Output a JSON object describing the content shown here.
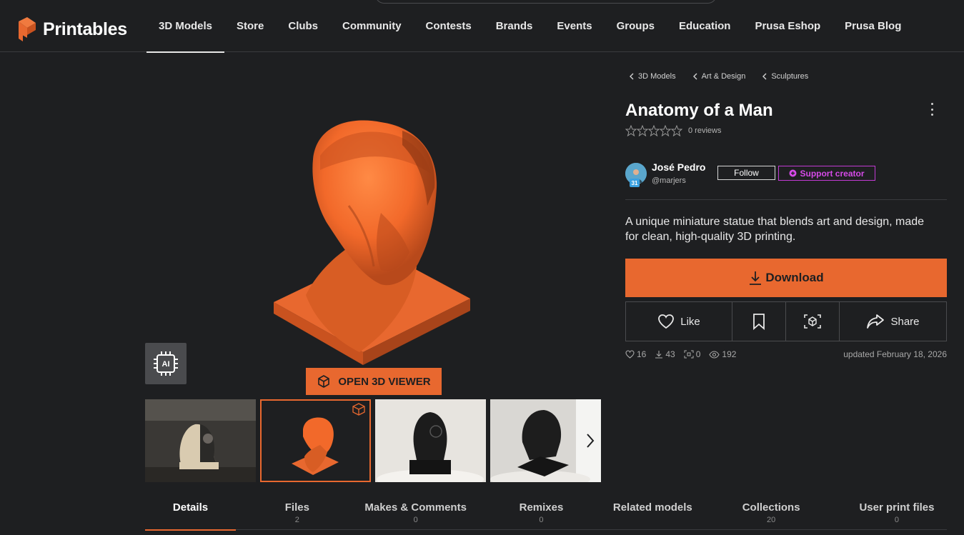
{
  "brand": {
    "name": "Printables",
    "accent": "#e8682f",
    "support_color": "#d54ae8"
  },
  "nav": [
    {
      "label": "3D Models",
      "active": true
    },
    {
      "label": "Store"
    },
    {
      "label": "Clubs"
    },
    {
      "label": "Community"
    },
    {
      "label": "Contests"
    },
    {
      "label": "Brands"
    },
    {
      "label": "Events"
    },
    {
      "label": "Groups"
    },
    {
      "label": "Education"
    },
    {
      "label": "Prusa Eshop"
    },
    {
      "label": "Prusa Blog"
    }
  ],
  "breadcrumbs": [
    "3D Models",
    "Art & Design",
    "Sculptures"
  ],
  "model": {
    "title": "Anatomy of a Man",
    "rating_stars": 0,
    "reviews": "0 reviews",
    "description": "A unique miniature statue that blends art and design, made for clean, high-quality 3D printing."
  },
  "author": {
    "name": "José Pedro",
    "handle": "@marjers",
    "level": "31",
    "follow_label": "Follow",
    "support_label": "Support creator"
  },
  "gallery": {
    "ai_label": "AI",
    "viewer_label": "OPEN 3D VIEWER",
    "thumbnail_count": 4,
    "selected_thumbnail": 2
  },
  "actions": {
    "download": "Download",
    "like": "Like",
    "share": "Share"
  },
  "stats": {
    "likes": "16",
    "downloads": "43",
    "makes": "0",
    "views": "192",
    "updated": "updated February 18, 2026"
  },
  "tabs": [
    {
      "label": "Details",
      "count": "",
      "active": true
    },
    {
      "label": "Files",
      "count": "2"
    },
    {
      "label": "Makes & Comments",
      "count": "0"
    },
    {
      "label": "Remixes",
      "count": "0"
    },
    {
      "label": "Related models",
      "count": ""
    },
    {
      "label": "Collections",
      "count": "20"
    },
    {
      "label": "User print files",
      "count": "0"
    }
  ]
}
